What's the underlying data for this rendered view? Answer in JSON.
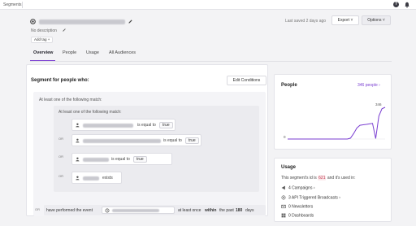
{
  "topbar": {
    "breadcrumb": "Segments"
  },
  "header": {
    "description": "No description",
    "add_tag_label": "Add tag +",
    "last_saved": "Last saved 2 days ago",
    "export_label": "Export ˅",
    "options_label": "Options ˅"
  },
  "tabs": [
    {
      "label": "Overview",
      "active": true
    },
    {
      "label": "People",
      "active": false
    },
    {
      "label": "Usage",
      "active": false
    },
    {
      "label": "All Audiences",
      "active": false
    }
  ],
  "segment": {
    "heading": "Segment for people who:",
    "edit_label": "Edit Conditions",
    "outer_match": "At least one of the following match:",
    "inner_match": "At least one of the following match:",
    "or_label": "OR",
    "rules": [
      {
        "operator": "is equal to",
        "value": "true"
      },
      {
        "operator": "is equal to",
        "value": "true"
      },
      {
        "operator": "is equal to",
        "value": "true"
      },
      {
        "operator": "exists",
        "value": ""
      }
    ],
    "event": {
      "prefix": "have performed the event",
      "suffix_1": "at least once",
      "within": "within",
      "suffix_2": "the past",
      "days": "180",
      "days_unit": "days"
    }
  },
  "people": {
    "title": "People",
    "link": "346 people ›",
    "chart_data": {
      "type": "line",
      "y_start_label": "0",
      "y_end_label": "346",
      "series": [
        {
          "values": [
            0,
            0,
            0,
            0,
            0,
            0,
            0,
            0,
            0,
            0,
            0,
            0,
            0,
            0,
            0,
            0,
            0,
            0,
            0,
            0,
            10,
            60,
            120,
            150,
            155,
            160,
            165,
            170,
            5,
            250,
            330,
            346
          ]
        }
      ],
      "color": "#7a3ed1"
    }
  },
  "usage": {
    "title": "Usage",
    "id_prefix": "This segment's id is",
    "id_value": "621",
    "id_suffix": "and it's used in:",
    "items": [
      {
        "label": "4 Campaigns",
        "icon": "campaign-icon",
        "chevron": "›"
      },
      {
        "label": "3 API Triggered Broadcasts",
        "icon": "broadcast-icon",
        "chevron": "›"
      },
      {
        "label": "0 Newsletters",
        "icon": "newsletter-icon",
        "chevron": ""
      },
      {
        "label": "0 Dashboards",
        "icon": "dashboard-icon",
        "chevron": ""
      }
    ]
  }
}
